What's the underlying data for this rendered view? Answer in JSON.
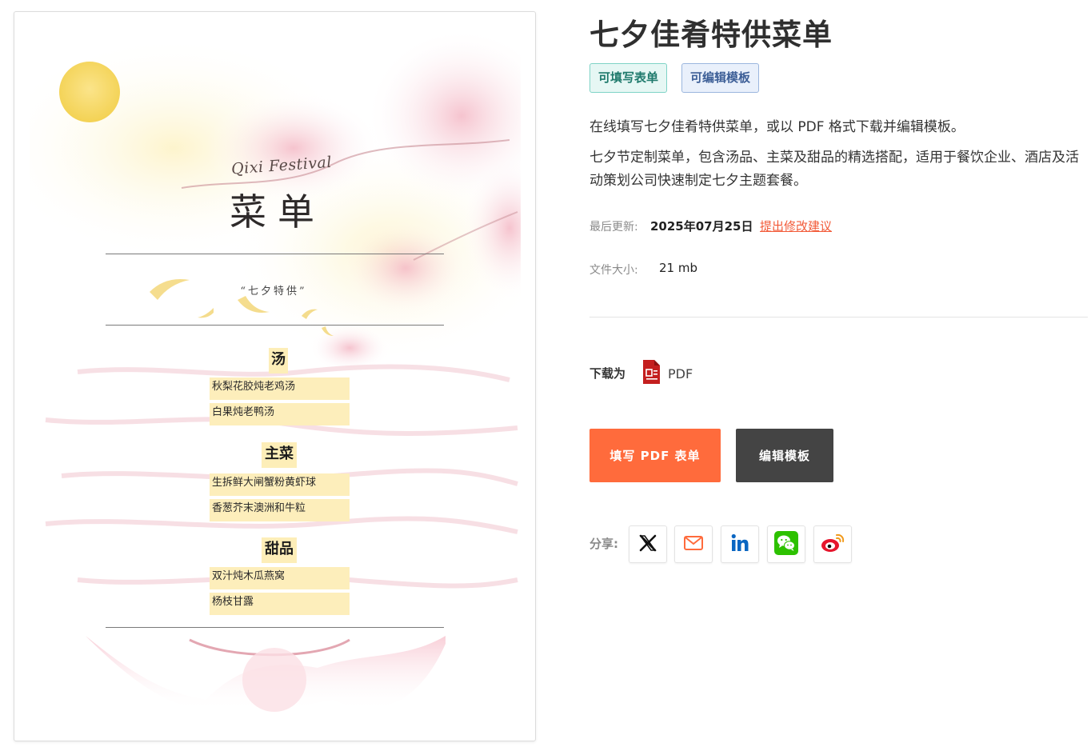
{
  "preview": {
    "festival_text": "Qixi Festival",
    "menu_title": "菜单",
    "tagline": "“七夕特供”",
    "sections": [
      {
        "title": "汤",
        "dishes": [
          "秋梨花胶炖老鸡汤",
          "白果炖老鸭汤"
        ]
      },
      {
        "title": "主菜",
        "dishes": [
          "生拆鲜大闸蟹粉黄虾球",
          "香葱芥末澳洲和牛粒"
        ]
      },
      {
        "title": "甜品",
        "dishes": [
          "双汁炖木瓜燕窝",
          "杨枝甘露"
        ]
      }
    ]
  },
  "details": {
    "title": "七夕佳肴特供菜单",
    "tags": [
      "可填写表单",
      "可编辑模板"
    ],
    "description_1": "在线填写七夕佳肴特供菜单，或以 PDF 格式下载并编辑模板。",
    "description_2": "七夕节定制菜单，包含汤品、主菜及甜品的精选搭配，适用于餐饮企业、酒店及活动策划公司快速制定七夕主题套餐。",
    "last_updated_label": "最后更新:",
    "last_updated_value": "2025年07月25日",
    "suggest_link": "提出修改建议",
    "file_size_label": "文件大小:",
    "file_size_value": "21 mb",
    "download_label": "下载为",
    "download_format": "PDF",
    "fill_button": "填写 PDF 表单",
    "edit_button": "编辑模板",
    "share_label": "分享:",
    "share_icons": [
      "x-icon",
      "email-icon",
      "linkedin-icon",
      "wechat-icon",
      "weibo-icon"
    ]
  },
  "colors": {
    "accent_orange": "#ff6b3c",
    "dark_button": "#444444",
    "link_red": "#f25a38",
    "tag_teal": "#1f7a6c",
    "tag_blue": "#3d5f97"
  }
}
